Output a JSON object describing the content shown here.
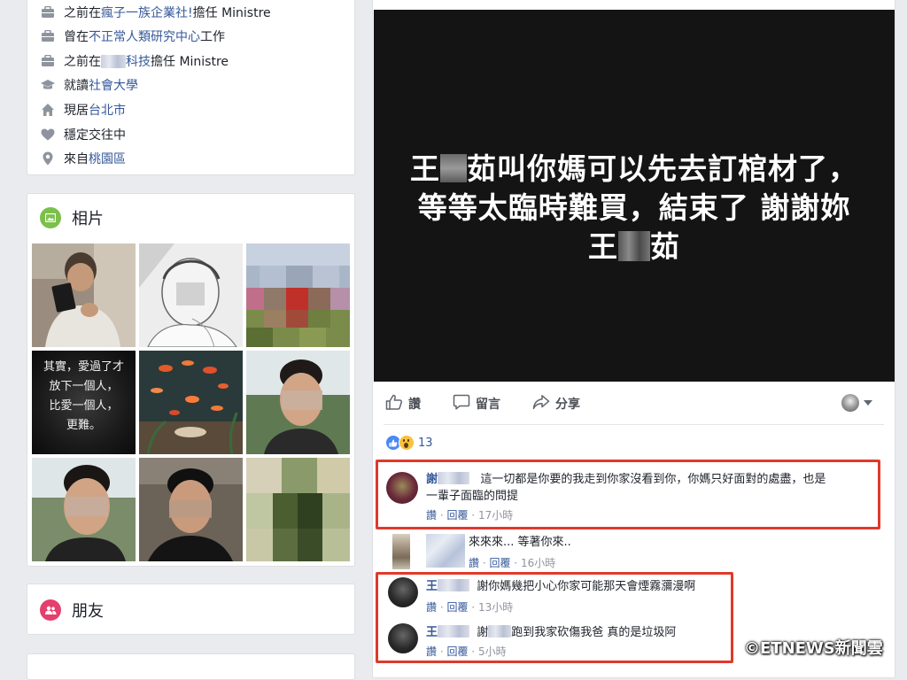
{
  "intro": {
    "items": [
      {
        "icon": "briefcase-icon",
        "prefix": "之前在",
        "link": "瘋子一族企業社!",
        "suffix": " 擔任 Ministre"
      },
      {
        "icon": "briefcase-icon",
        "prefix": "曾在",
        "link": "不正常人類研究中心",
        "suffix": "工作"
      },
      {
        "icon": "briefcase-icon",
        "prefix": "之前在",
        "link": "科技",
        "suffix": "擔任 Ministre"
      },
      {
        "icon": "graduation-cap-icon",
        "prefix": "就讀",
        "link": "社會大學",
        "suffix": ""
      },
      {
        "icon": "home-icon",
        "prefix": "現居",
        "link": "台北市",
        "suffix": ""
      },
      {
        "icon": "heart-icon",
        "prefix": "穩定交往中",
        "link": "",
        "suffix": ""
      },
      {
        "icon": "location-pin-icon",
        "prefix": "來自",
        "link": "桃園區",
        "suffix": ""
      }
    ]
  },
  "photos": {
    "title": "相片",
    "caption_lines": [
      "其實，愛過了才",
      "放下一個人，",
      "比愛一個人，",
      "更難。"
    ]
  },
  "friends": {
    "title": "朋友"
  },
  "post": {
    "image_lines": [
      "王",
      "茹叫你媽可以先去訂棺材了，",
      "等等太臨時難買，結束了 謝謝妳",
      "王",
      "茹"
    ],
    "actions": {
      "like": "讚",
      "comment": "留言",
      "share": "分享"
    },
    "reaction_count": "13"
  },
  "comments": [
    {
      "name": "謝",
      "text_line1": "這一切都是你要的我走到你家沒看到你，你媽只好面對的處盡，也是",
      "text_line2": "一輩子面臨的問提",
      "like": "讚",
      "reply": "回覆",
      "time": "17小時"
    },
    {
      "name": "",
      "text_line1": "來來來... 等著你來..",
      "text_line2": "",
      "like": "讚",
      "reply": "回覆",
      "time": "16小時"
    },
    {
      "name": "王",
      "text_line1": "謝你媽幾把小心你家可能那天會煙霧瀰漫啊",
      "text_line2": "",
      "like": "讚",
      "reply": "回覆",
      "time": "13小時"
    },
    {
      "name": "王",
      "text_line1": "謝",
      "text_line1b": "跑到我家砍傷我爸 真的是垃圾阿",
      "text_line2": "",
      "like": "讚",
      "reply": "回覆",
      "time": "5小時"
    }
  ],
  "watermark": "©ETNEWS新聞雲",
  "colors": {
    "highlight_box": "#e0392b",
    "link": "#365899",
    "post_bg": "#141414"
  }
}
